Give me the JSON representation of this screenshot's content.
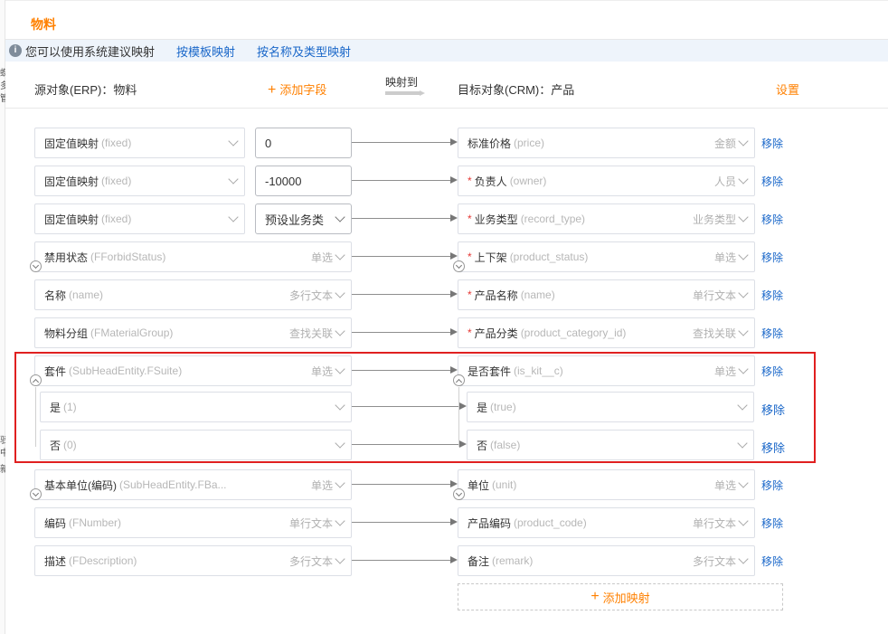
{
  "tab": {
    "label": "物料"
  },
  "infobar": {
    "text": "您可以使用系统建议映射",
    "link_template": "按模板映射",
    "link_name_type": "按名称及类型映射"
  },
  "header": {
    "source": "源对象(ERP)：物料",
    "add_field": "添加字段",
    "map_to": "映射到",
    "target": "目标对象(CRM)：产品",
    "settings": "设置"
  },
  "edge_fragments": [
    "蝶",
    "多",
    "管",
    "驳",
    "中",
    "新"
  ],
  "rows": [
    {
      "src_label": "固定值映射",
      "src_api": "(fixed)",
      "src_type": "",
      "value": "0",
      "value_kind": "input",
      "tgt_req": false,
      "tgt_label": "标准价格",
      "tgt_api": "(price)",
      "tgt_type": "金额",
      "remove": "移除"
    },
    {
      "src_label": "固定值映射",
      "src_api": "(fixed)",
      "src_type": "",
      "value": "-10000",
      "value_kind": "input",
      "tgt_req": true,
      "tgt_label": "负责人",
      "tgt_api": "(owner)",
      "tgt_type": "人员",
      "remove": "移除"
    },
    {
      "src_label": "固定值映射",
      "src_api": "(fixed)",
      "src_type": "",
      "value": "预设业务类",
      "value_kind": "select",
      "tgt_req": true,
      "tgt_label": "业务类型",
      "tgt_api": "(record_type)",
      "tgt_type": "业务类型",
      "remove": "移除"
    },
    {
      "src_label": "禁用状态",
      "src_api": "(FForbidStatus)",
      "src_type": "单选",
      "tgt_req": true,
      "tgt_label": "上下架",
      "tgt_api": "(product_status)",
      "tgt_type": "单选",
      "remove": "移除"
    },
    {
      "src_label": "名称",
      "src_api": "(name)",
      "src_type": "多行文本",
      "tgt_req": true,
      "tgt_label": "产品名称",
      "tgt_api": "(name)",
      "tgt_type": "单行文本",
      "remove": "移除"
    },
    {
      "src_label": "物料分组",
      "src_api": "(FMaterialGroup)",
      "src_type": "查找关联",
      "tgt_req": true,
      "tgt_label": "产品分类",
      "tgt_api": "(product_category_id)",
      "tgt_type": "查找关联",
      "remove": "移除"
    },
    {
      "src_label": "套件",
      "src_api": "(SubHeadEntity.FSuite)",
      "src_type": "单选",
      "tgt_req": false,
      "tgt_label": "是否套件",
      "tgt_api": "(is_kit__c)",
      "tgt_type": "单选",
      "remove": "移除"
    },
    {
      "src_label": "是",
      "src_api": "(1)",
      "src_type": "",
      "tgt_req": false,
      "tgt_label": "是",
      "tgt_api": "(true)",
      "tgt_type": "",
      "remove": "移除"
    },
    {
      "src_label": "否",
      "src_api": "(0)",
      "src_type": "",
      "tgt_req": false,
      "tgt_label": "否",
      "tgt_api": "(false)",
      "tgt_type": "",
      "remove": "移除"
    },
    {
      "src_label": "基本单位(编码)",
      "src_api": "(SubHeadEntity.FBa...",
      "src_type": "单选",
      "tgt_req": false,
      "tgt_label": "单位",
      "tgt_api": "(unit)",
      "tgt_type": "单选",
      "remove": "移除"
    },
    {
      "src_label": "编码",
      "src_api": "(FNumber)",
      "src_type": "单行文本",
      "tgt_req": false,
      "tgt_label": "产品编码",
      "tgt_api": "(product_code)",
      "tgt_type": "单行文本",
      "remove": "移除"
    },
    {
      "src_label": "描述",
      "src_api": "(FDescription)",
      "src_type": "多行文本",
      "tgt_req": false,
      "tgt_label": "备注",
      "tgt_api": "(remark)",
      "tgt_type": "多行文本",
      "remove": "移除"
    }
  ],
  "add_mapping": "添加映射",
  "colors": {
    "accent": "#ff8000",
    "link": "#1a67c9",
    "highlight_box": "#e02020"
  }
}
